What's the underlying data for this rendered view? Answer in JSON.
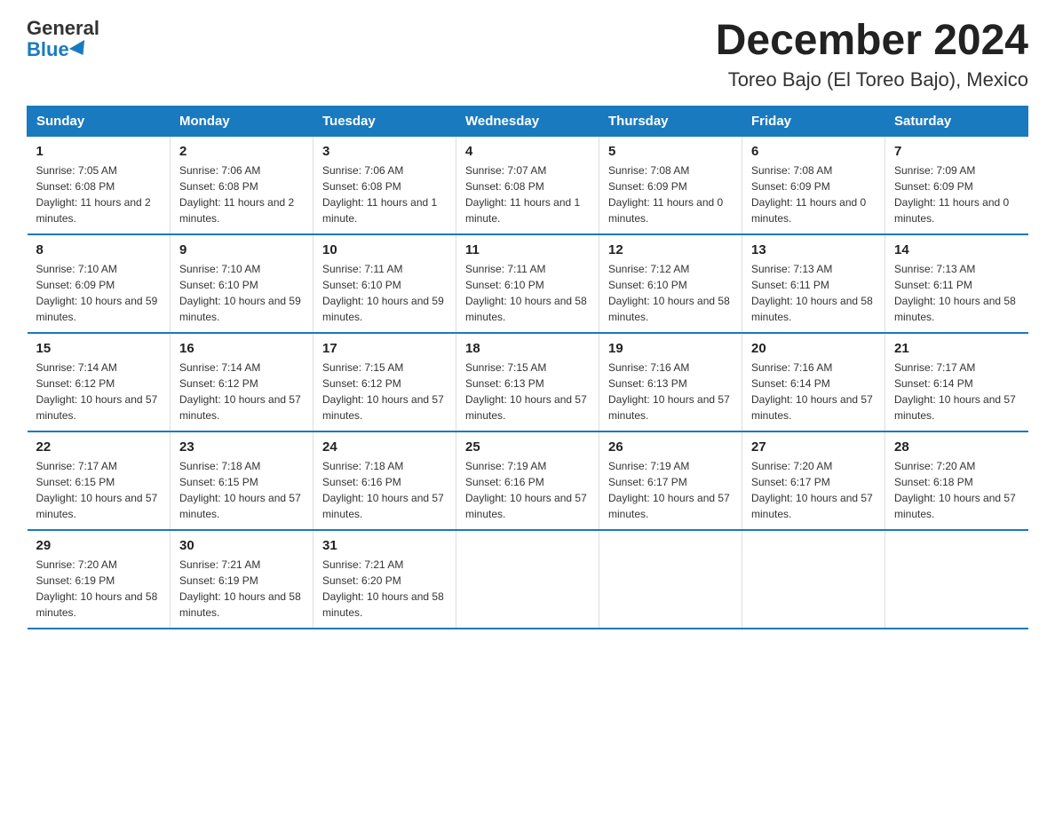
{
  "logo": {
    "general": "General",
    "blue": "Blue"
  },
  "title": "December 2024",
  "subtitle": "Toreo Bajo (El Toreo Bajo), Mexico",
  "headers": [
    "Sunday",
    "Monday",
    "Tuesday",
    "Wednesday",
    "Thursday",
    "Friday",
    "Saturday"
  ],
  "weeks": [
    [
      {
        "day": "1",
        "sunrise": "7:05 AM",
        "sunset": "6:08 PM",
        "daylight": "11 hours and 2 minutes."
      },
      {
        "day": "2",
        "sunrise": "7:06 AM",
        "sunset": "6:08 PM",
        "daylight": "11 hours and 2 minutes."
      },
      {
        "day": "3",
        "sunrise": "7:06 AM",
        "sunset": "6:08 PM",
        "daylight": "11 hours and 1 minute."
      },
      {
        "day": "4",
        "sunrise": "7:07 AM",
        "sunset": "6:08 PM",
        "daylight": "11 hours and 1 minute."
      },
      {
        "day": "5",
        "sunrise": "7:08 AM",
        "sunset": "6:09 PM",
        "daylight": "11 hours and 0 minutes."
      },
      {
        "day": "6",
        "sunrise": "7:08 AM",
        "sunset": "6:09 PM",
        "daylight": "11 hours and 0 minutes."
      },
      {
        "day": "7",
        "sunrise": "7:09 AM",
        "sunset": "6:09 PM",
        "daylight": "11 hours and 0 minutes."
      }
    ],
    [
      {
        "day": "8",
        "sunrise": "7:10 AM",
        "sunset": "6:09 PM",
        "daylight": "10 hours and 59 minutes."
      },
      {
        "day": "9",
        "sunrise": "7:10 AM",
        "sunset": "6:10 PM",
        "daylight": "10 hours and 59 minutes."
      },
      {
        "day": "10",
        "sunrise": "7:11 AM",
        "sunset": "6:10 PM",
        "daylight": "10 hours and 59 minutes."
      },
      {
        "day": "11",
        "sunrise": "7:11 AM",
        "sunset": "6:10 PM",
        "daylight": "10 hours and 58 minutes."
      },
      {
        "day": "12",
        "sunrise": "7:12 AM",
        "sunset": "6:10 PM",
        "daylight": "10 hours and 58 minutes."
      },
      {
        "day": "13",
        "sunrise": "7:13 AM",
        "sunset": "6:11 PM",
        "daylight": "10 hours and 58 minutes."
      },
      {
        "day": "14",
        "sunrise": "7:13 AM",
        "sunset": "6:11 PM",
        "daylight": "10 hours and 58 minutes."
      }
    ],
    [
      {
        "day": "15",
        "sunrise": "7:14 AM",
        "sunset": "6:12 PM",
        "daylight": "10 hours and 57 minutes."
      },
      {
        "day": "16",
        "sunrise": "7:14 AM",
        "sunset": "6:12 PM",
        "daylight": "10 hours and 57 minutes."
      },
      {
        "day": "17",
        "sunrise": "7:15 AM",
        "sunset": "6:12 PM",
        "daylight": "10 hours and 57 minutes."
      },
      {
        "day": "18",
        "sunrise": "7:15 AM",
        "sunset": "6:13 PM",
        "daylight": "10 hours and 57 minutes."
      },
      {
        "day": "19",
        "sunrise": "7:16 AM",
        "sunset": "6:13 PM",
        "daylight": "10 hours and 57 minutes."
      },
      {
        "day": "20",
        "sunrise": "7:16 AM",
        "sunset": "6:14 PM",
        "daylight": "10 hours and 57 minutes."
      },
      {
        "day": "21",
        "sunrise": "7:17 AM",
        "sunset": "6:14 PM",
        "daylight": "10 hours and 57 minutes."
      }
    ],
    [
      {
        "day": "22",
        "sunrise": "7:17 AM",
        "sunset": "6:15 PM",
        "daylight": "10 hours and 57 minutes."
      },
      {
        "day": "23",
        "sunrise": "7:18 AM",
        "sunset": "6:15 PM",
        "daylight": "10 hours and 57 minutes."
      },
      {
        "day": "24",
        "sunrise": "7:18 AM",
        "sunset": "6:16 PM",
        "daylight": "10 hours and 57 minutes."
      },
      {
        "day": "25",
        "sunrise": "7:19 AM",
        "sunset": "6:16 PM",
        "daylight": "10 hours and 57 minutes."
      },
      {
        "day": "26",
        "sunrise": "7:19 AM",
        "sunset": "6:17 PM",
        "daylight": "10 hours and 57 minutes."
      },
      {
        "day": "27",
        "sunrise": "7:20 AM",
        "sunset": "6:17 PM",
        "daylight": "10 hours and 57 minutes."
      },
      {
        "day": "28",
        "sunrise": "7:20 AM",
        "sunset": "6:18 PM",
        "daylight": "10 hours and 57 minutes."
      }
    ],
    [
      {
        "day": "29",
        "sunrise": "7:20 AM",
        "sunset": "6:19 PM",
        "daylight": "10 hours and 58 minutes."
      },
      {
        "day": "30",
        "sunrise": "7:21 AM",
        "sunset": "6:19 PM",
        "daylight": "10 hours and 58 minutes."
      },
      {
        "day": "31",
        "sunrise": "7:21 AM",
        "sunset": "6:20 PM",
        "daylight": "10 hours and 58 minutes."
      },
      null,
      null,
      null,
      null
    ]
  ],
  "labels": {
    "sunrise": "Sunrise:",
    "sunset": "Sunset:",
    "daylight": "Daylight:"
  }
}
